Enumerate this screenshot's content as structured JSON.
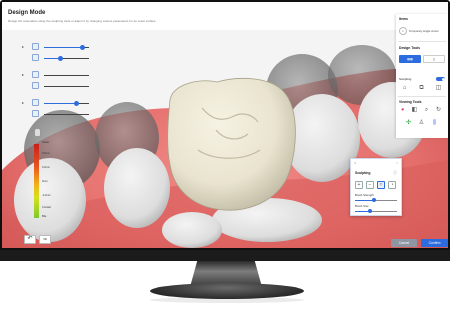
{
  "app": {
    "title": "Design Mode",
    "subtitle": "Design the restoration using the sculpting tools or adjust it by changing various parameters for an exact surface."
  },
  "left_sliders": [
    {
      "icon": "crown-outline-icon",
      "value": 0.85
    },
    {
      "icon": "margin-line-icon",
      "value": 0.35
    },
    {
      "icon": "antagonist-icon",
      "value": 0.0
    },
    {
      "icon": "tooth-slice-icon",
      "value": 0.0
    },
    {
      "icon": "bridge-icon",
      "value": 0.7
    },
    {
      "icon": "gingiva-icon",
      "value": 0.0
    }
  ],
  "legend": {
    "title": "Scaler",
    "labels": [
      "0.5mm",
      "0.2mm",
      "0mm",
      "-0.2mm",
      "Contact",
      "Bite"
    ]
  },
  "bottom_left": {
    "undo_icon": "undo-icon",
    "view_label": "3D"
  },
  "right_panel": {
    "step_title": "Items",
    "step_number": "1",
    "step_label": "Temporary single crown",
    "design_tools_title": "Design Tools",
    "sculpting_label": "Sculpting",
    "sculpting_on": true,
    "viewing_tools_title": "Viewing Tools"
  },
  "sculpt_popup": {
    "title": "Sculpting",
    "tools": [
      "add-icon",
      "remove-icon",
      "smooth-icon",
      "morph-icon"
    ],
    "selected_tool": 3,
    "brush_strength_label": "Brush Strength",
    "brush_strength": 0.45,
    "brush_size_label": "Brush Size",
    "brush_size": 0.35
  },
  "actions": {
    "cancel": "Cancel",
    "confirm": "Confirm"
  },
  "colors": {
    "accent": "#2d6cdf",
    "gum": "#e56f6c",
    "crown": "#e9e4cf",
    "tooth": "#dcdcdc"
  }
}
